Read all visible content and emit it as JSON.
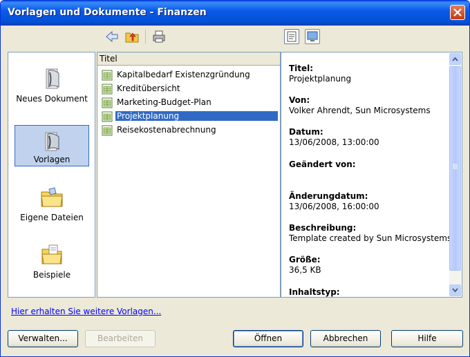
{
  "window": {
    "title": "Vorlagen und Dokumente - Finanzen"
  },
  "toolbar": {
    "back_icon": "arrow-left-icon",
    "up_icon": "folder-up-icon",
    "print_icon": "printer-icon",
    "view_document_icon": "document-properties-icon",
    "view_preview_icon": "preview-icon"
  },
  "categories": [
    {
      "label": "Neues Dokument",
      "icon": "new-document-icon"
    },
    {
      "label": "Vorlagen",
      "icon": "templates-icon",
      "selected": true
    },
    {
      "label": "Eigene Dateien",
      "icon": "folder-icon"
    },
    {
      "label": "Beispiele",
      "icon": "samples-folder-icon"
    }
  ],
  "file_list": {
    "column_header": "Titel",
    "items": [
      {
        "label": "Kapitalbedarf Existenzgründung"
      },
      {
        "label": "Kreditübersicht"
      },
      {
        "label": "Marketing-Budget-Plan"
      },
      {
        "label": "Projektplanung",
        "selected": true
      },
      {
        "label": "Reisekostenabrechnung"
      }
    ]
  },
  "properties": [
    {
      "label": "Titel:",
      "value": "Projektplanung"
    },
    {
      "label": "Von:",
      "value": "Volker Ahrendt, Sun Microsystems"
    },
    {
      "label": "Datum:",
      "value": "13/06/2008, 13:00:00"
    },
    {
      "label": "Geändert von:",
      "value": ""
    },
    {
      "label": "Änderungdatum:",
      "value": "13/06/2008, 16:00:00"
    },
    {
      "label": "Beschreibung:",
      "value": "Template created by Sun Microsystems"
    },
    {
      "label": "Größe:",
      "value": "36,5 KB"
    },
    {
      "label": "Inhaltstyp:",
      "value": ""
    }
  ],
  "more_templates_link": "Hier erhalten Sie weitere Vorlagen...",
  "buttons": {
    "manage": "Verwalten...",
    "edit": "Bearbeiten",
    "open": "Öffnen",
    "cancel": "Abbrechen",
    "help": "Hilfe"
  },
  "colors": {
    "titlebar": "#0a5ae8",
    "selection": "#316ac5",
    "link": "#0000ff"
  }
}
